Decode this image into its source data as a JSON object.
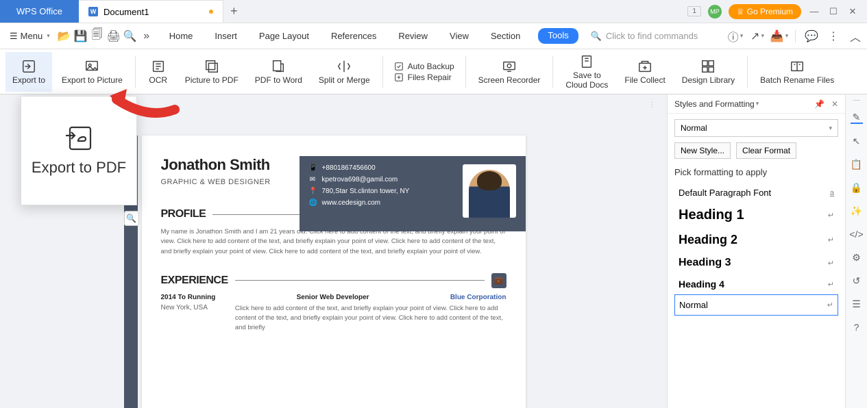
{
  "titlebar": {
    "app_name": "WPS Office",
    "doc_name": "Document1",
    "badge_num": "1",
    "avatar": "MP",
    "premium": "Go Premium"
  },
  "menu": {
    "menu_label": "Menu",
    "tabs": [
      "Home",
      "Insert",
      "Page Layout",
      "References",
      "Review",
      "View",
      "Section",
      "Tools"
    ],
    "active_tab": "Tools",
    "search_placeholder": "Click to find commands"
  },
  "ribbon": {
    "export_to": "Export to",
    "export_picture": "Export to Picture",
    "ocr": "OCR",
    "picture_pdf": "Picture to PDF",
    "pdf_word": "PDF to Word",
    "split_merge": "Split or Merge",
    "auto_backup": "Auto Backup",
    "files_repair": "Files Repair",
    "screen_recorder": "Screen Recorder",
    "save_cloud_1": "Save to",
    "save_cloud_2": "Cloud Docs",
    "file_collect": "File Collect",
    "design_library": "Design Library",
    "batch_rename": "Batch Rename Files"
  },
  "popup": {
    "label": "Export to PDF"
  },
  "doc": {
    "name": "Jonathon Smith",
    "role": "GRAPHIC & WEB DESIGNER",
    "phone": "+8801867456600",
    "email": "kpetrova698@gamil.com",
    "address": "780,Star St.clinton tower, NY",
    "website": "www.cedesign.com",
    "profile_title": "PROFILE",
    "profile_body": "My name is Jonathon Smith and I am 21 years old. Click here to add content of the text, and briefly explain your point of view. Click here to add content of the text, and briefly explain your point of view. Click here to add content of the text, and briefly explain your point of view. Click here to add content of the text, and briefly explain your point of view.",
    "experience_title": "EXPERIENCE",
    "exp_date": "2014 To Running",
    "exp_role": "Senior Web Developer",
    "exp_company": "Blue Corporation",
    "exp_loc": "New York, USA",
    "exp_body": "Click here to add content of the text, and briefly explain your point of view. Click here to add content of the text, and briefly explain your point of view. Click here to add content of the text, and briefly"
  },
  "panel": {
    "title": "Styles and Formatting",
    "select_value": "Normal",
    "new_style": "New Style...",
    "clear_format": "Clear Format",
    "pick_label": "Pick formatting to apply",
    "styles": [
      "Default Paragraph Font",
      "Heading 1",
      "Heading 2",
      "Heading 3",
      "Heading 4",
      "Normal"
    ]
  }
}
